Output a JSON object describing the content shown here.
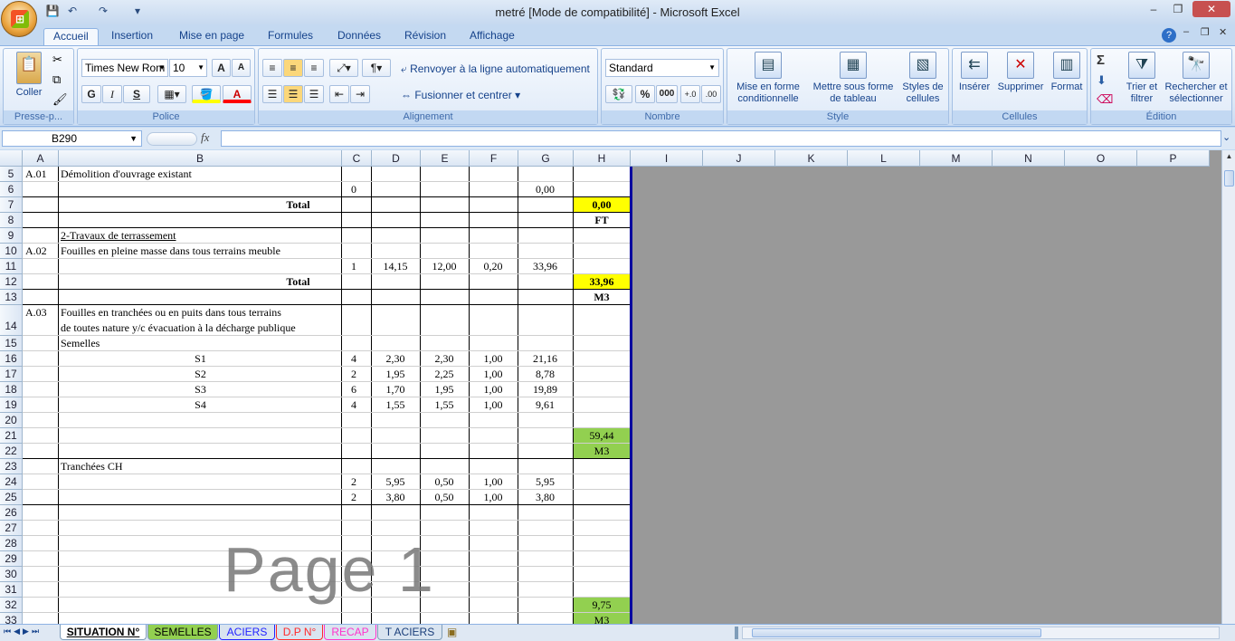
{
  "window": {
    "title": "metré  [Mode de compatibilité] - Microsoft Excel",
    "minimize": "–",
    "restore": "❐",
    "close": "✕",
    "inner_minimize": "–",
    "inner_restore": "❐",
    "inner_close": "✕",
    "help": "?"
  },
  "qat": {
    "save": "💾",
    "undo": "↶",
    "redo": "↷",
    "more": "▾"
  },
  "tabs": [
    "Accueil",
    "Insertion",
    "Mise en page",
    "Formules",
    "Données",
    "Révision",
    "Affichage"
  ],
  "ribbon": {
    "clipboard": {
      "paste": "Coller",
      "label": "Presse-p..."
    },
    "font": {
      "name": "Times New Rom",
      "size": "10",
      "grow": "A",
      "shrink": "A",
      "bold": "G",
      "italic": "I",
      "underline": "S",
      "label": "Police"
    },
    "alignment": {
      "wrap": "Renvoyer à la ligne automatiquement",
      "merge": "Fusionner et centrer",
      "label": "Alignement"
    },
    "number": {
      "format": "Standard",
      "percent": "%",
      "thousands": "000",
      "label": "Nombre"
    },
    "style": {
      "cond": "Mise en forme conditionnelle",
      "table": "Mettre sous forme de tableau",
      "cells": "Styles de cellules",
      "label": "Style"
    },
    "cells": {
      "insert": "Insérer",
      "delete": "Supprimer",
      "format": "Format",
      "label": "Cellules"
    },
    "editing": {
      "sort": "Trier et filtrer",
      "find": "Rechercher et sélectionner",
      "label": "Édition",
      "sigma": "Σ"
    }
  },
  "formula_bar": {
    "name_box": "B290",
    "fx": "fx",
    "formula": ""
  },
  "columns": [
    "A",
    "B",
    "C",
    "D",
    "E",
    "F",
    "G",
    "H",
    "I",
    "J",
    "K",
    "L",
    "M",
    "N",
    "O",
    "P"
  ],
  "rows": [
    {
      "n": "5",
      "A": "A.01",
      "B": "Démolition d'ouvrage existant"
    },
    {
      "n": "6",
      "C": "0",
      "G": "0,00"
    },
    {
      "n": "7",
      "B": "Total",
      "H": "0,00"
    },
    {
      "n": "8",
      "H": "FT"
    },
    {
      "n": "9",
      "B": "2-Travaux de terrassement"
    },
    {
      "n": "10",
      "A": "A.02",
      "B": "Fouilles en pleine masse dans tous terrains meuble"
    },
    {
      "n": "11",
      "C": "1",
      "D": "14,15",
      "E": "12,00",
      "F": "0,20",
      "G": "33,96"
    },
    {
      "n": "12",
      "B": "Total",
      "H": "33,96"
    },
    {
      "n": "13",
      "H": "M3"
    },
    {
      "n": "14",
      "A": "A.03",
      "B": "Fouilles en tranchées ou en puits dans tous terrains",
      "B2": "de toutes nature y/c évacuation à la décharge publique"
    },
    {
      "n": "15",
      "B": "Semelles"
    },
    {
      "n": "16",
      "B": "S1",
      "C": "4",
      "D": "2,30",
      "E": "2,30",
      "F": "1,00",
      "G": "21,16"
    },
    {
      "n": "17",
      "B": "S2",
      "C": "2",
      "D": "1,95",
      "E": "2,25",
      "F": "1,00",
      "G": "8,78"
    },
    {
      "n": "18",
      "B": "S3",
      "C": "6",
      "D": "1,70",
      "E": "1,95",
      "F": "1,00",
      "G": "19,89"
    },
    {
      "n": "19",
      "B": "S4",
      "C": "4",
      "D": "1,55",
      "E": "1,55",
      "F": "1,00",
      "G": "9,61"
    },
    {
      "n": "20"
    },
    {
      "n": "21",
      "H": "59,44"
    },
    {
      "n": "22",
      "H": "M3"
    },
    {
      "n": "23",
      "B": "Tranchées CH"
    },
    {
      "n": "24",
      "C": "2",
      "D": "5,95",
      "E": "0,50",
      "F": "1,00",
      "G": "5,95"
    },
    {
      "n": "25",
      "C": "2",
      "D": "3,80",
      "E": "0,50",
      "F": "1,00",
      "G": "3,80"
    },
    {
      "n": "26"
    },
    {
      "n": "27"
    },
    {
      "n": "28"
    },
    {
      "n": "29"
    },
    {
      "n": "30"
    },
    {
      "n": "31"
    },
    {
      "n": "32",
      "H": "9,75"
    },
    {
      "n": "33",
      "H": "M3"
    }
  ],
  "watermark": "Page 1",
  "sheet_tabs": [
    "SITUATION N°",
    "SEMELLES",
    "ACIERS",
    "D.P N°",
    "RECAP",
    "T ACIERS"
  ],
  "colors": {
    "yellow": "#ffff00",
    "green": "#92d050",
    "page_border": "#0000a0"
  }
}
